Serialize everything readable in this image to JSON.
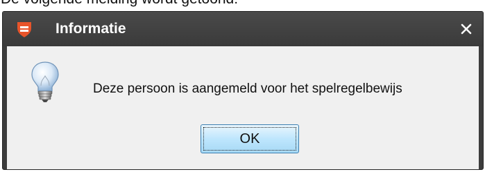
{
  "intro": {
    "text": "De volgende melding wordt getoond:"
  },
  "dialog": {
    "title": "Informatie",
    "close_label": "×",
    "message": "Deze persoon is aangemeld voor het spelregelbewijs",
    "ok_label": "OK",
    "icons": {
      "app": "app-logo-icon",
      "info": "lightbulb-icon",
      "close": "close-icon"
    },
    "colors": {
      "titlebar": "#3c3c3c",
      "content": "#f0f0f0",
      "app_icon": "#e8542a",
      "button_border": "#3c7fb1"
    }
  }
}
